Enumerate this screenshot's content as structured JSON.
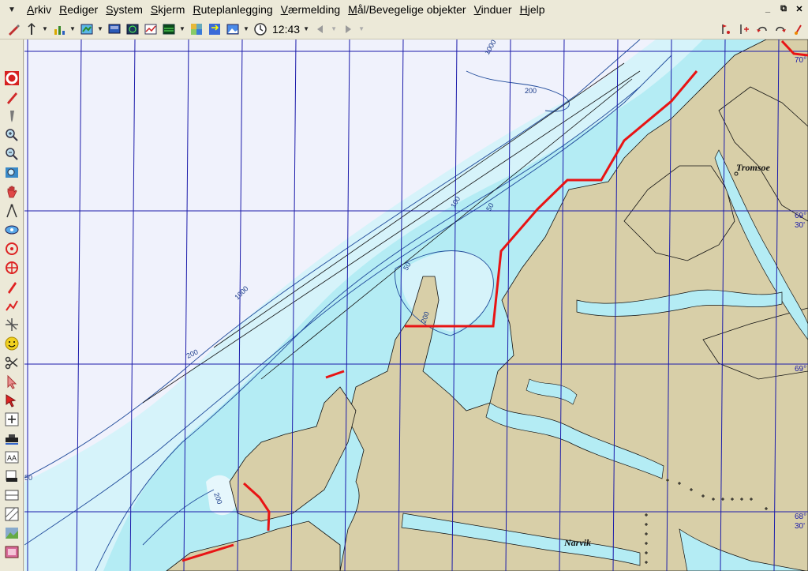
{
  "menu": {
    "items": [
      {
        "accel": "A",
        "rest": "rkiv"
      },
      {
        "accel": "R",
        "rest": "ediger"
      },
      {
        "accel": "S",
        "rest": "ystem"
      },
      {
        "accel": "S",
        "rest": "kjerm"
      },
      {
        "accel": "R",
        "rest": "uteplanlegging"
      },
      {
        "accel": "V",
        "rest": "ærmelding"
      },
      {
        "accel": "M",
        "rest": "ål/Bevegelige objekter"
      },
      {
        "accel": "V",
        "rest": "induer"
      },
      {
        "accel": "H",
        "rest": "jelp"
      }
    ]
  },
  "toolbar": {
    "time": "12:43"
  },
  "map": {
    "places": {
      "tromsoe": "Tromsoe",
      "narvik": "Narvik"
    },
    "lat_labels": {
      "l70": "70°",
      "l69_30": "69°",
      "l69_30b": "30'",
      "l69": "69°",
      "l68_30": "68°",
      "l68_30b": "30'"
    },
    "depths": {
      "d1000a": "1000",
      "d200a": "200",
      "d100a": "100",
      "d50a": "50",
      "d50b": "50",
      "d200b": "200",
      "d1000b": "1000",
      "d200c": "200",
      "d200d": "200",
      "d50c": "50"
    }
  },
  "colors": {
    "land": "#d8cfa8",
    "shallow": "#b4ecf4",
    "mid": "#d6f3fa",
    "deep": "#f0f2fc",
    "grid": "#1b1baa",
    "route": "#e81414",
    "contour": "#1f4a9a"
  }
}
